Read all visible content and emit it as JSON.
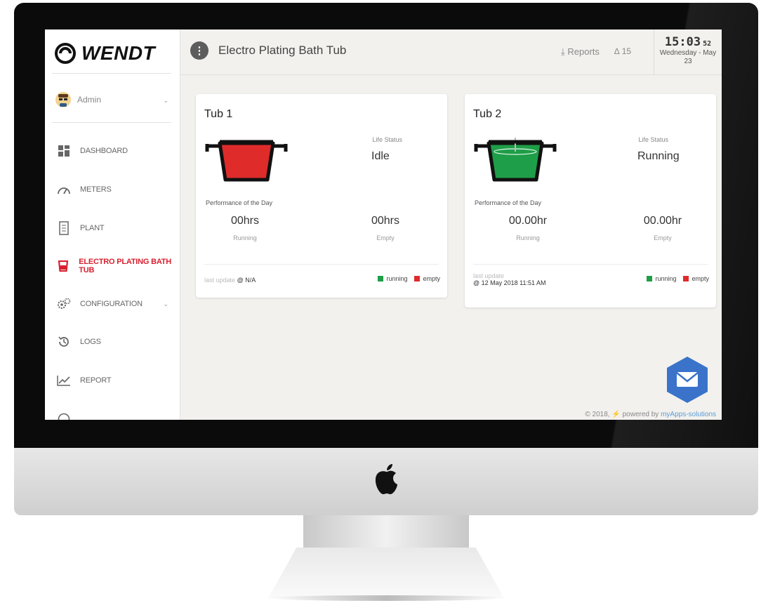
{
  "app": {
    "title": "Electro Plating Bath Tub",
    "logo_text": "WENDT",
    "menu_icon": "vertical-dots-icon"
  },
  "user": {
    "name": "Admin",
    "avatar_icon": "avatar-icon"
  },
  "sidebar": {
    "items": [
      {
        "label": "DASHBOARD",
        "icon": "dashboard-grid-icon"
      },
      {
        "label": "METERS",
        "icon": "gauge-icon"
      },
      {
        "label": "PLANT",
        "icon": "plant-building-icon"
      },
      {
        "label": "ELECTRO PLATING BATH TUB",
        "icon": "bath-tub-icon",
        "active": true
      },
      {
        "label": "CONFIGURATION",
        "icon": "gears-icon"
      },
      {
        "label": "LOGS",
        "icon": "history-icon"
      },
      {
        "label": "REPORT",
        "icon": "trend-chart-icon"
      }
    ],
    "active_color": "#d8202f"
  },
  "topbar": {
    "reports_label": "Reports",
    "reports_icon": "download-icon",
    "notifications": "15",
    "notification_icon": "bell-icon"
  },
  "clock": {
    "time": "15:03",
    "seconds": "52",
    "date_line1": "Wednesday - May",
    "date_line2": "23"
  },
  "tubs": [
    {
      "title": "Tub 1",
      "life_status_label": "Life Status",
      "life_status": "Idle",
      "fill_color": "#e02b2b",
      "performance_label": "Performance of the Day",
      "running_value": "00hrs",
      "running_label": "Running",
      "empty_value": "00hrs",
      "empty_label": "Empty",
      "last_update_label": "last update",
      "last_update_value": "@ N/A",
      "legend_running": "running",
      "legend_empty": "empty"
    },
    {
      "title": "Tub 2",
      "life_status_label": "Life Status",
      "life_status": "Running",
      "fill_color": "#1e9e48",
      "performance_label": "Performance of the Day",
      "running_value": "00.00hr",
      "running_label": "Running",
      "empty_value": "00.00hr",
      "empty_label": "Empty",
      "last_update_label": "last update",
      "last_update_value": "@ 12 May 2018 11:51 AM",
      "legend_running": "running",
      "legend_empty": "empty"
    }
  ],
  "legend_colors": {
    "running": "#1e9e48",
    "empty": "#e02b2b"
  },
  "footer": {
    "copyright": "© 2018,",
    "powered_by": "powered by",
    "brand": "myApps-solutions"
  },
  "fab": {
    "icon": "mail-icon",
    "color": "#3a73c9"
  }
}
